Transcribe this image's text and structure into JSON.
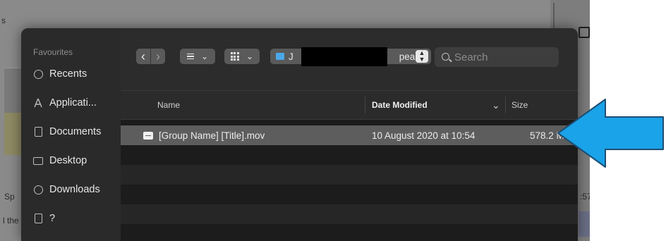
{
  "background": {
    "snippets": [
      "s",
      "Sp",
      "l the",
      ":57"
    ]
  },
  "sidebar": {
    "header": "Favourites",
    "items": [
      {
        "label": "Recents",
        "icon": "clock-icon"
      },
      {
        "label": "Applicati...",
        "icon": "applications-icon"
      },
      {
        "label": "Documents",
        "icon": "document-icon"
      },
      {
        "label": "Desktop",
        "icon": "desktop-icon"
      },
      {
        "label": "Downloads",
        "icon": "downloads-icon"
      },
      {
        "label": "?",
        "icon": "document-icon"
      }
    ]
  },
  "toolbar": {
    "back_glyph": "‹",
    "forward_glyph": "›",
    "chevron": "⌄",
    "location_prefix": "J",
    "location_suffix": "pea...",
    "search_placeholder": "Search"
  },
  "columns": {
    "name": "Name",
    "date": "Date Modified",
    "size": "Size"
  },
  "files": [
    {
      "name": "[Group Name] [Title].mov",
      "date": "10 August 2020 at 10:54",
      "size": "578.2 M"
    }
  ],
  "colors": {
    "annotation_arrow": "#1aa3e8",
    "selection": "#5d5d5d",
    "folder": "#4aa8e8"
  }
}
